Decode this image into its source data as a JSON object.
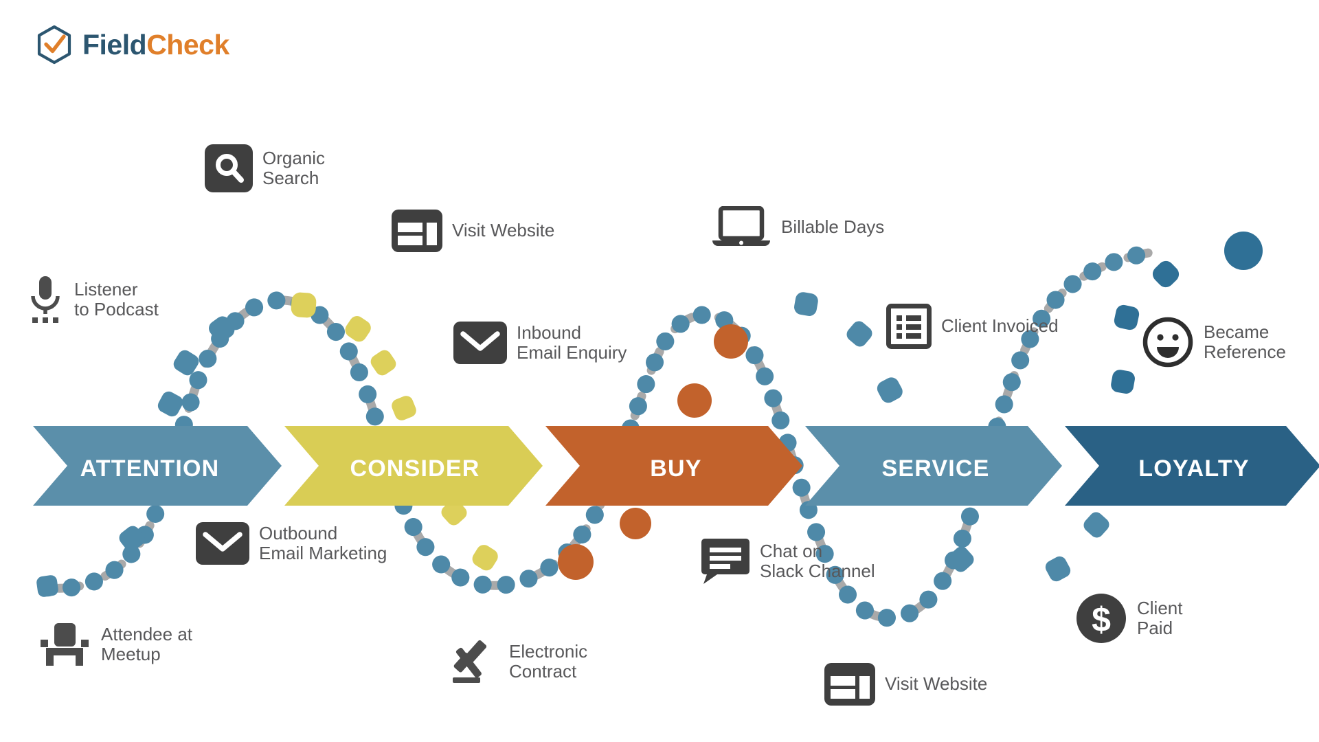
{
  "brand": {
    "name_part1": "Field",
    "name_part2": "Check",
    "logo_icon": "hexagon-check-icon",
    "color_primary": "#2c5670",
    "color_accent": "#e07f2a"
  },
  "diagram": {
    "type": "customer-journey-funnel",
    "stages": [
      {
        "id": "attention",
        "label": "ATTENTION",
        "color": "#5b8faa"
      },
      {
        "id": "consider",
        "label": "CONSIDER",
        "color": "#d9cd55"
      },
      {
        "id": "buy",
        "label": "BUY",
        "color": "#c2622c"
      },
      {
        "id": "service",
        "label": "SERVICE",
        "color": "#5b8faa"
      },
      {
        "id": "loyalty",
        "label": "LOYALTY",
        "color": "#2a6185"
      }
    ],
    "touchpoints": [
      {
        "id": "organic-search",
        "label": "Organic\nSearch",
        "icon": "search-icon",
        "stage": "attention",
        "position": "above"
      },
      {
        "id": "visit-website-1",
        "label": "Visit Website",
        "icon": "browser-icon",
        "stage": "consider",
        "position": "above"
      },
      {
        "id": "billable-days",
        "label": "Billable Days",
        "icon": "laptop-icon",
        "stage": "buy",
        "position": "above"
      },
      {
        "id": "listener-podcast",
        "label": "Listener\nto Podcast",
        "icon": "microphone-icon",
        "stage": "attention",
        "position": "above"
      },
      {
        "id": "inbound-email",
        "label": "Inbound\nEmail Enquiry",
        "icon": "envelope-icon",
        "stage": "consider",
        "position": "above"
      },
      {
        "id": "client-invoiced",
        "label": "Client Invoiced",
        "icon": "list-icon",
        "stage": "service",
        "position": "above"
      },
      {
        "id": "became-reference",
        "label": "Became\nReference",
        "icon": "smiley-icon",
        "stage": "loyalty",
        "position": "above"
      },
      {
        "id": "outbound-email",
        "label": "Outbound\nEmail Marketing",
        "icon": "envelope-icon",
        "stage": "attention",
        "position": "below"
      },
      {
        "id": "attendee-meetup",
        "label": "Attendee at\nMeetup",
        "icon": "chair-icon",
        "stage": "attention",
        "position": "below"
      },
      {
        "id": "electronic-contract",
        "label": "Electronic\nContract",
        "icon": "gavel-icon",
        "stage": "consider",
        "position": "below"
      },
      {
        "id": "chat-slack",
        "label": "Chat on\nSlack Channel",
        "icon": "chat-bubble-icon",
        "stage": "buy",
        "position": "below"
      },
      {
        "id": "visit-website-2",
        "label": "Visit Website",
        "icon": "browser-icon",
        "stage": "service",
        "position": "below"
      },
      {
        "id": "client-paid",
        "label": "Client\nPaid",
        "icon": "dollar-coin-icon",
        "stage": "loyalty",
        "position": "below"
      }
    ],
    "wave": {
      "description": "dashed sine wave weaving through the stage chevrons",
      "dash_colors": [
        "#a8a8a8",
        "#5b8faa",
        "#d9cd55",
        "#c2622c",
        "#2a6185"
      ]
    }
  }
}
